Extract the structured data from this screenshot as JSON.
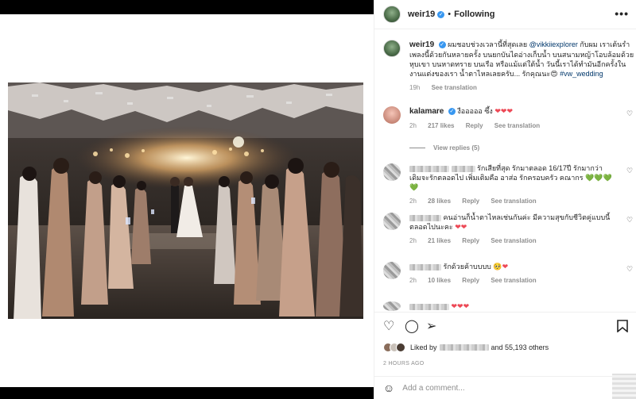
{
  "header": {
    "username": "weir19",
    "separator": "•",
    "follow_status": "Following",
    "more": "•••"
  },
  "caption": {
    "username": "weir19",
    "text_before_mention": "ผมชอบช่วงเวลานี้ที่สุดเลย",
    "mention": "@vikkiiexplorer",
    "text_after_mention": "กับผม เราเต้นรำเพลงนี้ด้วยกันหลายครั้ง บนยกบันไดอ่างเก็บน้ำ บนสนามหญ้าโอบล้อมด้วยหุบเขา บนหาดทราย บนเรือ หรือแม้แต่ใต้น้ำ วันนี้เราได้ทำมันอีกครั้งในงานแต่งของเรา น้ำตาไหลเลยครับ... รักคุณนะ",
    "emoji": "😍",
    "hashtag": "#vw_wedding",
    "time": "19h",
    "see_translation": "See translation"
  },
  "comments": [
    {
      "username": "kalamare",
      "verified": true,
      "text": "งือออออ ซึ้ง",
      "hearts": "❤❤❤",
      "time": "2h",
      "likes": "217 likes",
      "reply": "Reply",
      "see_translation": "See translation",
      "view_replies": "View replies (5)"
    },
    {
      "text": "รักเสียที่สุด รักมาตลอด 16/17ปี รักมากว่าเดิมจะรักตลอดไป เพิ่มเติมคือ อาส่อ รักครอบครัว คณากร",
      "hearts": "💚💚💚💚",
      "time": "2h",
      "likes": "28 likes",
      "reply": "Reply",
      "see_translation": "See translation"
    },
    {
      "text": "คนอ่านก็น้ำตาไหลเช่นกันค่ะ มีความสุขกับชีวิตคู่แบบนี้ตลอดไปนะคะ",
      "hearts": "❤❤",
      "time": "2h",
      "likes": "21 likes",
      "reply": "Reply",
      "see_translation": "See translation"
    },
    {
      "text": "รักด้วยค้าบบบบ",
      "hearts": "🥺❤",
      "time": "2h",
      "likes": "10 likes",
      "reply": "Reply",
      "see_translation": "See translation"
    },
    {
      "hearts": "❤❤❤"
    }
  ],
  "actions": {
    "liked_by_prefix": "Liked by",
    "liked_by_suffix": "and 55,193 others",
    "time_ago": "2 HOURS AGO",
    "add_comment_placeholder": "Add a comment..."
  },
  "colors": {
    "verified": "#3897f0",
    "link": "#00376b",
    "heart": "#ed4956"
  }
}
